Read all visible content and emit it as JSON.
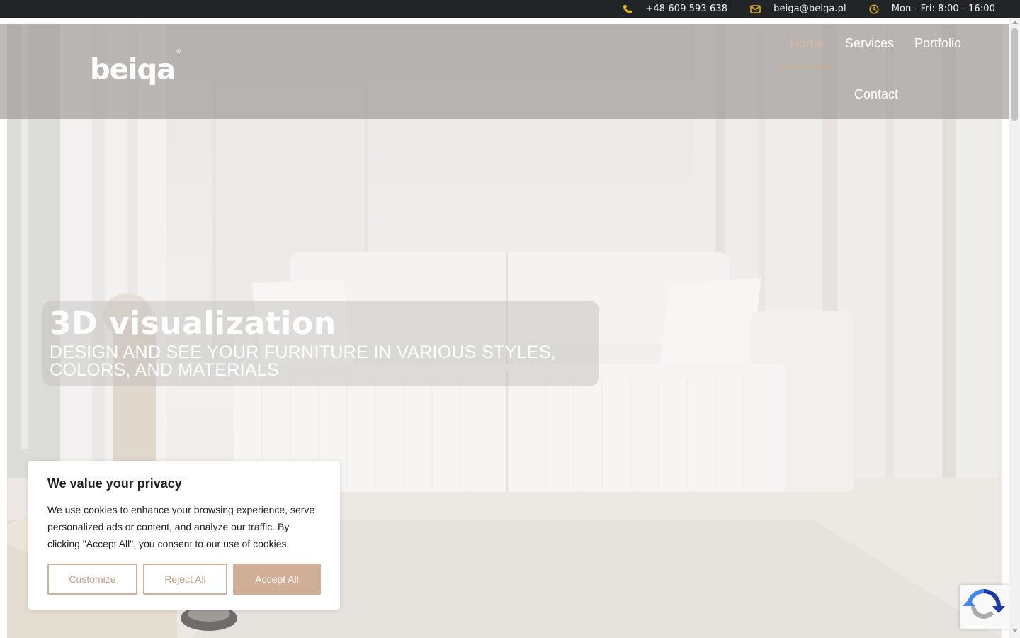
{
  "topbar": {
    "phone": "+48 609 593 638",
    "email": "beiga@beiga.pl",
    "hours": "Mon - Fri: 8:00 - 16:00",
    "icon_color": "#e5b513"
  },
  "header": {
    "logo": "beiqa",
    "logo_mark": "®",
    "nav": {
      "home": "Home",
      "services": "Services",
      "portfolio": "Portfolio",
      "contact": "Contact"
    },
    "active_color": "#d8b9a3"
  },
  "hero": {
    "title": "3D visualization",
    "subtitle": "DESIGN AND SEE YOUR FURNITURE IN VARIOUS STYLES, COLORS, AND MATERIALS"
  },
  "cookie": {
    "title": "We value your privacy",
    "text": "We use cookies to enhance your browsing experience, serve personalized ads or content, and analyze our traffic. By clicking \"Accept All\", you consent to our use of cookies.",
    "customize": "Customize",
    "reject": "Reject All",
    "accept": "Accept All",
    "accent_color": "#d1ae96"
  }
}
